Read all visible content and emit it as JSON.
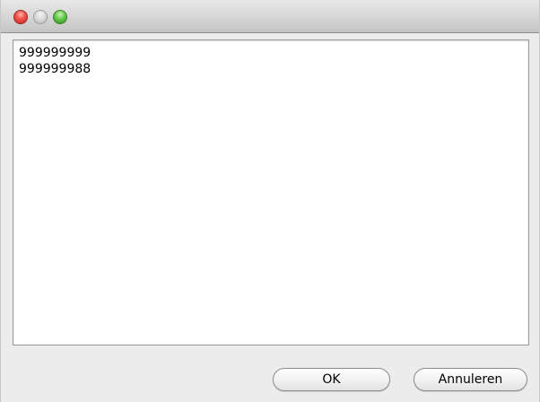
{
  "window": {
    "controls": [
      "close-icon",
      "minimize-icon",
      "zoom-icon"
    ]
  },
  "text_area": {
    "lines": [
      "999999999",
      "999999988"
    ]
  },
  "buttons": {
    "ok_label": "OK",
    "cancel_label": "Annuleren"
  },
  "colors": {
    "close": "#f0574e",
    "minimize": "#d8d8d8",
    "zoom": "#63c94a",
    "window_bg": "#ececec"
  }
}
